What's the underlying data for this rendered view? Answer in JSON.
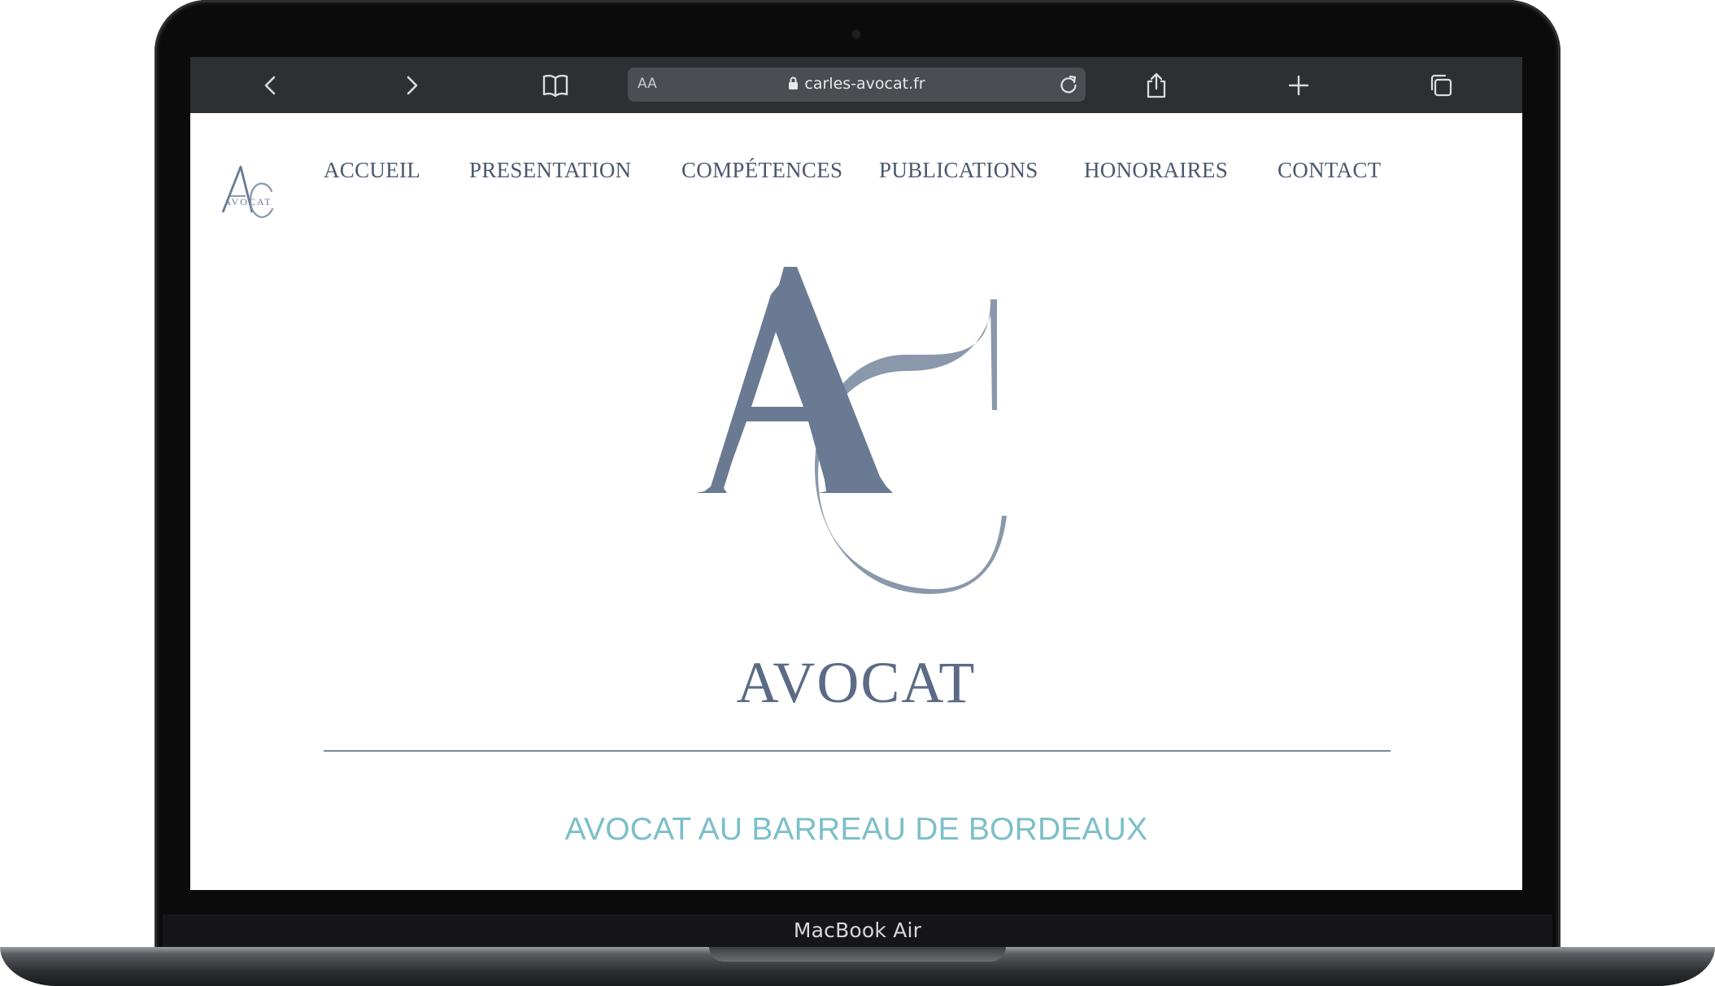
{
  "device": {
    "model_label": "MacBook Air"
  },
  "browser": {
    "reader_label": "AA",
    "url": "carles-avocat.fr",
    "icons": {
      "back": "chevron-left-icon",
      "forward": "chevron-right-icon",
      "bookmarks": "book-icon",
      "lock": "lock-icon",
      "reload": "reload-icon",
      "share": "share-icon",
      "new_tab": "plus-icon",
      "tabs": "tabs-icon"
    }
  },
  "site": {
    "logo": {
      "monogram": "AC",
      "word": "AVOCAT"
    },
    "nav": [
      {
        "label": "ACCUEIL"
      },
      {
        "label": "PRESENTATION"
      },
      {
        "label": "COMPÉTENCES"
      },
      {
        "label": "PUBLICATIONS"
      },
      {
        "label": "HONORAIRES"
      },
      {
        "label": "CONTACT"
      }
    ],
    "hero": {
      "monogram": "AC",
      "title": "AVOCAT",
      "tagline": "AVOCAT AU BARREAU DE BORDEAUX"
    }
  },
  "colors": {
    "brand_slate": "#5b6b86",
    "brand_slate_light": "#8a98ab",
    "nav_text": "#4b586e",
    "accent_teal": "#7cbfc9",
    "toolbar": "#2d3033"
  }
}
